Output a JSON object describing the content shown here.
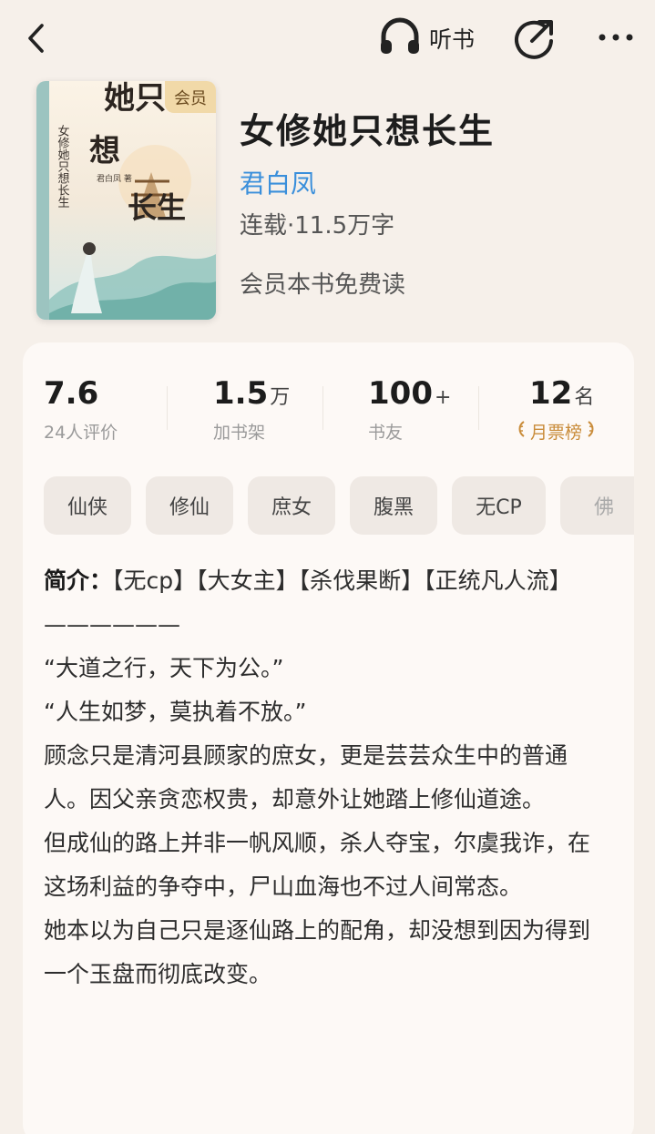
{
  "topbar": {
    "back_icon": "chevron-left-icon",
    "listen_label": "听书",
    "headphone_icon": "headphone-icon",
    "share_icon": "share-icon",
    "more_icon": "more-icon"
  },
  "book": {
    "badge": "会员",
    "title": "女修她只想长生",
    "author": "君白凤",
    "status": "连载·11.5万字",
    "free_read": "会员本书免费读",
    "cover_title_text": "女修她只想长生",
    "cover_author_text": "君白凤 著"
  },
  "stats": [
    {
      "value": "7.6",
      "unit": "",
      "label": "24人评价"
    },
    {
      "value": "1.5",
      "unit": "万",
      "label": "加书架"
    },
    {
      "value": "100",
      "unit": "+",
      "label": "书友"
    },
    {
      "value": "12",
      "unit": "名",
      "label": "月票榜"
    }
  ],
  "tags": [
    "仙侠",
    "修仙",
    "庶女",
    "腹黑",
    "无CP",
    "佛"
  ],
  "intro": {
    "head": "简介：",
    "first": "【无cp】【大女主】【杀伐果断】【正统凡人流】",
    "lines": [
      "——————",
      "“大道之行，天下为公。”",
      "“人生如梦，莫执着不放。”",
      "顾念只是清河县顾家的庶女，更是芸芸众生中的普通人。因父亲贪恋权贵，却意外让她踏上修仙道途。",
      "但成仙的路上并非一帆风顺，杀人夺宝，尔虞我诈，在这场利益的争夺中，尸山血海也不过人间常态。",
      "她本以为自己只是逐仙路上的配角，却没想到因为得到一个玉盘而彻底改变。"
    ]
  },
  "colors": {
    "background": "#f6f0ea",
    "card": "#fdf9f6",
    "author": "#3a8fdb",
    "rank": "#c98c3a",
    "vip_badge": "#f1d9a8"
  }
}
